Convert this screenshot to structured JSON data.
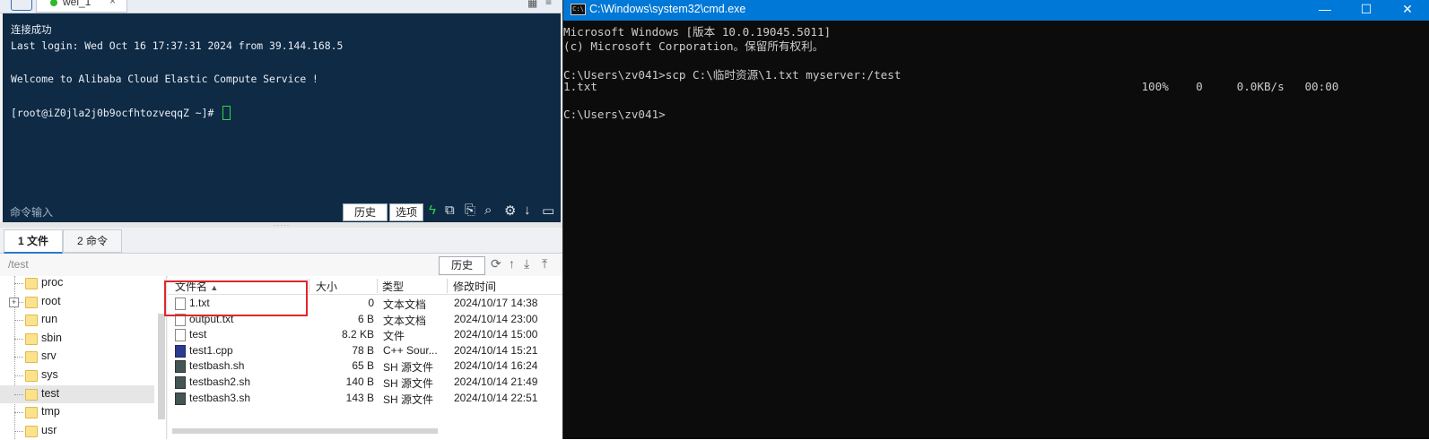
{
  "session": {
    "tab_label": "wei_1"
  },
  "terminal": {
    "lines": [
      "连接成功",
      "Last login: Wed Oct 16 17:37:31 2024 from 39.144.168.5",
      "",
      "Welcome to Alibaba Cloud Elastic Compute Service !",
      "",
      "[root@iZ0jla2j0b9ocfhtozveqqZ ~]# "
    ],
    "input_label": "命令输入",
    "history_button": "历史",
    "options_button": "选项"
  },
  "bottom_tabs": [
    "1 文件",
    "2 命令"
  ],
  "path": {
    "current": "/test",
    "history_button": "历史"
  },
  "tree": {
    "items": [
      {
        "name": "proc",
        "selected": false
      },
      {
        "name": "root",
        "selected": false,
        "expandable": true
      },
      {
        "name": "run",
        "selected": false
      },
      {
        "name": "sbin",
        "selected": false
      },
      {
        "name": "srv",
        "selected": false
      },
      {
        "name": "sys",
        "selected": false
      },
      {
        "name": "test",
        "selected": true
      },
      {
        "name": "tmp",
        "selected": false
      },
      {
        "name": "usr",
        "selected": false
      }
    ]
  },
  "files": {
    "headers": {
      "name": "文件名",
      "size": "大小",
      "type": "类型",
      "modified": "修改时间"
    },
    "rows": [
      {
        "icon": "text-file-icon",
        "name": "1.txt",
        "size": "0",
        "type": "文本文档",
        "modified": "2024/10/17 14:38"
      },
      {
        "icon": "text-file-icon",
        "name": "output.txt",
        "size": "6 B",
        "type": "文本文档",
        "modified": "2024/10/14 23:00"
      },
      {
        "icon": "file-icon",
        "name": "test",
        "size": "8.2 KB",
        "type": "文件",
        "modified": "2024/10/14 15:00"
      },
      {
        "icon": "cpp-file-icon",
        "name": "test1.cpp",
        "size": "78 B",
        "type": "C++ Sour...",
        "modified": "2024/10/14 15:21"
      },
      {
        "icon": "shell-file-icon",
        "name": "testbash.sh",
        "size": "65 B",
        "type": "SH 源文件",
        "modified": "2024/10/14 16:24"
      },
      {
        "icon": "shell-file-icon",
        "name": "testbash2.sh",
        "size": "140 B",
        "type": "SH 源文件",
        "modified": "2024/10/14 21:49"
      },
      {
        "icon": "shell-file-icon",
        "name": "testbash3.sh",
        "size": "143 B",
        "type": "SH 源文件",
        "modified": "2024/10/14 22:51"
      }
    ]
  },
  "cmd": {
    "title": "C:\\Windows\\system32\\cmd.exe",
    "icon_text": "C:\\",
    "lines": [
      "Microsoft Windows [版本 10.0.19045.5011]",
      "(c) Microsoft Corporation。保留所有权利。",
      "",
      "C:\\Users\\zv041>scp C:\\临时资源\\1.txt myserver:/test",
      "1.txt                                                                                100%    0     0.0KB/s   00:00",
      "",
      "C:\\Users\\zv041>"
    ],
    "controls": {
      "minimize": "—",
      "maximize": "☐",
      "close": "✕"
    }
  },
  "colors": {
    "terminal_bg": "#0f2a44",
    "cmd_titlebar": "#0078d7",
    "cmd_bg": "#0c0c0c",
    "highlight": "#e0262b"
  }
}
